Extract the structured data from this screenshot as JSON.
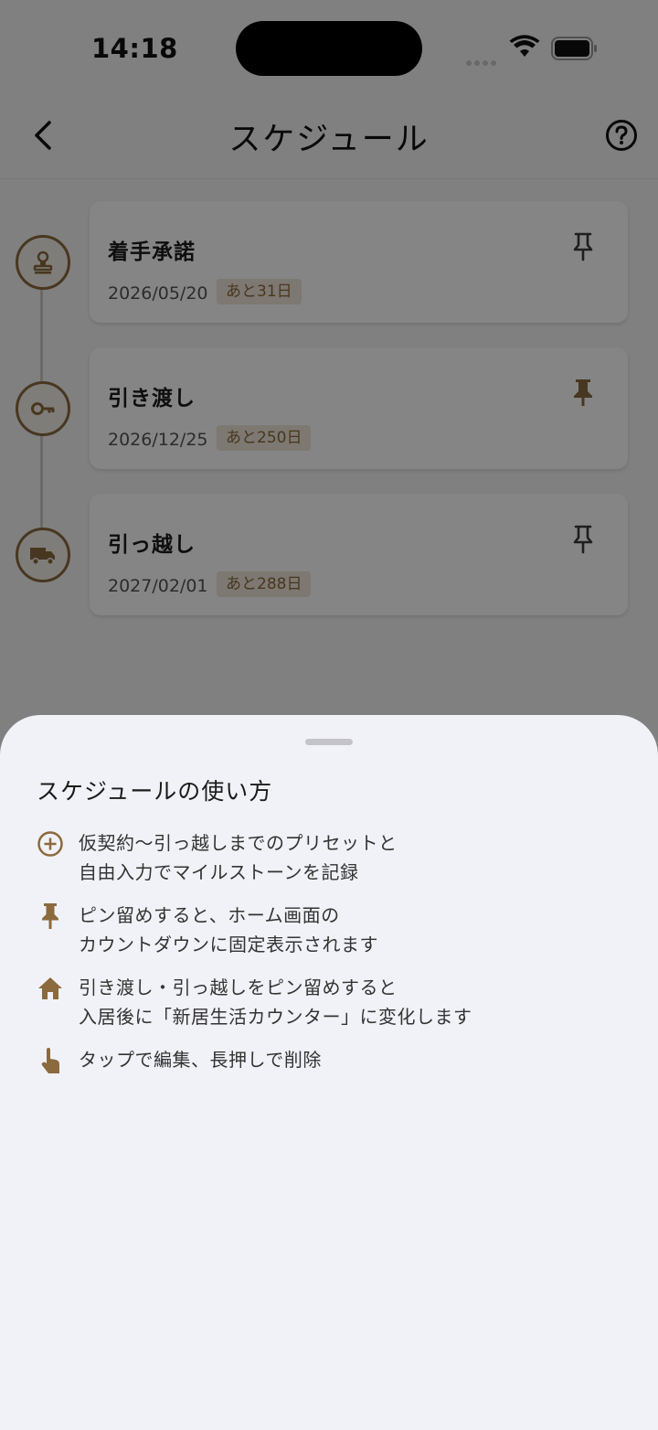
{
  "status_bar": {
    "time": "14:18"
  },
  "app_bar": {
    "title": "スケジュール"
  },
  "milestones": [
    {
      "title": "着手承諾",
      "date": "2026/05/20",
      "badge": "あと31日",
      "pinned": false,
      "icon": "stamp-icon"
    },
    {
      "title": "引き渡し",
      "date": "2026/12/25",
      "badge": "あと250日",
      "pinned": true,
      "icon": "key-icon"
    },
    {
      "title": "引っ越し",
      "date": "2027/02/01",
      "badge": "あと288日",
      "pinned": false,
      "icon": "truck-icon"
    }
  ],
  "help_sheet": {
    "title": "スケジュールの使い方",
    "tips": [
      {
        "icon": "add-circle-icon",
        "lines": [
          "仮契約〜引っ越しまでのプリセットと",
          "自由入力でマイルストーンを記録"
        ]
      },
      {
        "icon": "pin-icon",
        "lines": [
          "ピン留めすると、ホーム画面の",
          "カウントダウンに固定表示されます"
        ]
      },
      {
        "icon": "home-icon",
        "lines": [
          "引き渡し・引っ越しをピン留めすると",
          "入居後に「新居生活カウンター」に変化します"
        ]
      },
      {
        "icon": "tap-hand-icon",
        "lines": [
          "タップで編集、長押しで削除"
        ]
      }
    ]
  },
  "colors": {
    "accent": "#8b6a3e",
    "badge_bg": "#efe6d8",
    "sheet_bg": "#f1f2f7"
  }
}
